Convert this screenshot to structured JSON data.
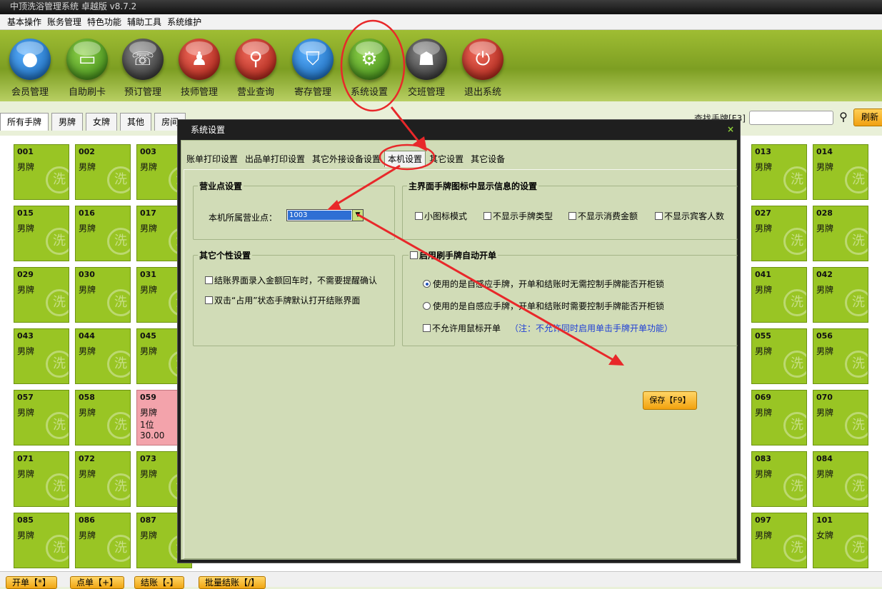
{
  "app": {
    "title": "中顶洗浴管理系统 卓越版 v8.7.2"
  },
  "menu": [
    "基本操作",
    "账务管理",
    "特色功能",
    "辅助工具",
    "系统维护"
  ],
  "toolbar": [
    {
      "label": "会员管理",
      "icon": "member-icon",
      "color": "#1d7ccf"
    },
    {
      "label": "自助刷卡",
      "icon": "card-icon",
      "color": "#4a9c1c"
    },
    {
      "label": "预订管理",
      "icon": "phone-icon",
      "color": "#3a3a3a"
    },
    {
      "label": "技师管理",
      "icon": "technician-icon",
      "color": "#c4261b"
    },
    {
      "label": "营业查询",
      "icon": "search-icon",
      "color": "#c4261b"
    },
    {
      "label": "寄存管理",
      "icon": "bag-icon",
      "color": "#1d7ccf"
    },
    {
      "label": "系统设置",
      "icon": "gear-icon",
      "color": "#4a9c1c"
    },
    {
      "label": "交班管理",
      "icon": "meeting-icon",
      "color": "#3a3a3a"
    },
    {
      "label": "退出系统",
      "icon": "power-icon",
      "color": "#c4261b"
    }
  ],
  "tabs": [
    "所有手牌",
    "男牌",
    "女牌",
    "其他",
    "房间"
  ],
  "search": {
    "label": "查找手牌[F3]",
    "refresh_label": "刷新"
  },
  "tiles": [
    {
      "num": "001",
      "type": "男牌"
    },
    {
      "num": "002",
      "type": "男牌"
    },
    {
      "num": "003",
      "type": "男牌"
    },
    {
      "num": "013",
      "type": "男牌"
    },
    {
      "num": "014",
      "type": "男牌"
    },
    {
      "num": "015",
      "type": "男牌"
    },
    {
      "num": "016",
      "type": "男牌"
    },
    {
      "num": "017",
      "type": "男牌"
    },
    {
      "num": "027",
      "type": "男牌"
    },
    {
      "num": "028",
      "type": "男牌"
    },
    {
      "num": "029",
      "type": "男牌"
    },
    {
      "num": "030",
      "type": "男牌"
    },
    {
      "num": "031",
      "type": "男牌"
    },
    {
      "num": "041",
      "type": "男牌"
    },
    {
      "num": "042",
      "type": "男牌"
    },
    {
      "num": "043",
      "type": "男牌"
    },
    {
      "num": "044",
      "type": "男牌"
    },
    {
      "num": "045",
      "type": "男牌"
    },
    {
      "num": "055",
      "type": "男牌"
    },
    {
      "num": "056",
      "type": "男牌"
    },
    {
      "num": "057",
      "type": "男牌"
    },
    {
      "num": "058",
      "type": "男牌"
    },
    {
      "num": "059",
      "type": "男牌",
      "guests": "1位",
      "amount": "30.00",
      "occupied": true
    },
    {
      "num": "069",
      "type": "男牌"
    },
    {
      "num": "070",
      "type": "男牌"
    },
    {
      "num": "071",
      "type": "男牌"
    },
    {
      "num": "072",
      "type": "男牌"
    },
    {
      "num": "073",
      "type": "男牌"
    },
    {
      "num": "083",
      "type": "男牌"
    },
    {
      "num": "084",
      "type": "男牌"
    },
    {
      "num": "085",
      "type": "男牌"
    },
    {
      "num": "086",
      "type": "男牌"
    },
    {
      "num": "087",
      "type": "男牌"
    },
    {
      "num": "097",
      "type": "男牌"
    },
    {
      "num": "101",
      "type": "女牌"
    }
  ],
  "bottom_buttons": [
    "开单【*】",
    "点单【+】",
    "结账【-】",
    "批量结账【/】"
  ],
  "dialog": {
    "title": "系统设置",
    "close": "×",
    "tabs": [
      "账单打印设置",
      "出品单打印设置",
      "其它外接设备设置",
      "本机设置",
      "其它设置",
      "其它设备"
    ],
    "active_tab": "本机设置",
    "business_point": {
      "title": "营业点设置",
      "label": "本机所属营业点：",
      "value": "1003"
    },
    "display": {
      "title": "主界面手牌图标中显示信息的设置",
      "options": [
        "小图标模式",
        "不显示手牌类型",
        "不显示消费金额",
        "不显示宾客人数"
      ]
    },
    "personal": {
      "title": "其它个性设置",
      "options": [
        "结账界面录入金额回车时，不需要提醒确认",
        "双击“占用”状态手牌默认打开结账界面"
      ]
    },
    "auto_open": {
      "title": "启用刷手牌自动开单",
      "radio1": "使用的是自感应手牌，开单和结账时无需控制手牌能否开柜锁",
      "radio2": "使用的是自感应手牌，开单和结账时需要控制手牌能否开柜锁",
      "mouse_label": "不允许用鼠标开单",
      "note": "（注：不允许同时启用单击手牌开单功能）"
    },
    "save_label": "保存【F9】"
  }
}
